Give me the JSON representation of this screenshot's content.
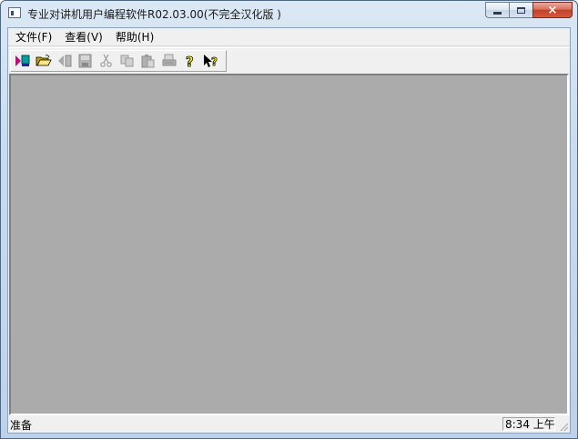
{
  "window": {
    "title": "专业对讲机用户编程软件R02.03.00(不完全汉化版 )"
  },
  "caption_buttons": {
    "minimize": "minimize-icon",
    "maximize": "restore-icon",
    "close": "×"
  },
  "menu": {
    "items": [
      {
        "label": "文件(F)"
      },
      {
        "label": "查看(V)"
      },
      {
        "label": "帮助(H)"
      }
    ]
  },
  "toolbar": {
    "buttons": [
      {
        "icon": "read-radio-icon",
        "enabled": true
      },
      {
        "icon": "open-folder-icon",
        "enabled": true
      },
      {
        "icon": "write-radio-icon",
        "enabled": false
      },
      {
        "icon": "save-disk-icon",
        "enabled": false
      },
      {
        "icon": "cut-icon",
        "enabled": false
      },
      {
        "icon": "copy-icon",
        "enabled": false
      },
      {
        "icon": "paste-icon",
        "enabled": false
      },
      {
        "icon": "print-icon",
        "enabled": false
      },
      {
        "icon": "about-help-icon",
        "enabled": true
      },
      {
        "icon": "context-help-icon",
        "enabled": true
      }
    ]
  },
  "status": {
    "text": "准备",
    "clock": "8:34 上午"
  },
  "colors": {
    "mdi_background": "#ababab",
    "chrome": "#f0f0f0",
    "close_button": "#c4422b"
  }
}
